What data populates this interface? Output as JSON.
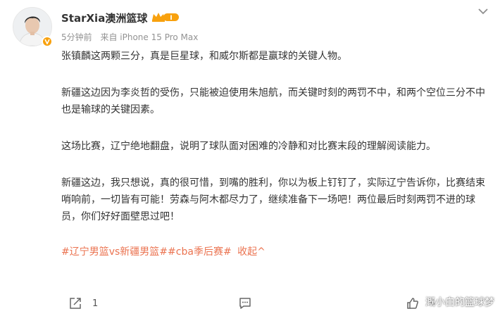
{
  "post": {
    "username": "StarXia澳洲篮球",
    "level_badge": "I",
    "time": "5分钟前",
    "source": "来自 iPhone 15 Pro Max",
    "paragraphs": [
      "张镇麟这两颗三分，真是巨星球，和威尔斯都是赢球的关键人物。",
      "新疆这边因为李炎哲的受伤，只能被迫使用朱旭航，而关键时刻的两罚不中，和两个空位三分不中也是输球的关键因素。",
      "这场比赛，辽宁绝地翻盘，说明了球队面对困难的冷静和对比赛末段的理解阅读能力。",
      "新疆这边，我只想说，真的很可惜，到嘴的胜利，你以为板上钉钉了，实际辽宁告诉你，比赛结束哨响前，一切皆有可能！劳森与阿木都尽力了，继续准备下一场吧！两位最后时刻两罚不进的球员，你们好好面壁思过吧！"
    ],
    "tags": [
      "#辽宁男篮vs新疆男篮#",
      "#cba季后赛#"
    ],
    "collapse_label": "收起",
    "collapse_glyph": "^"
  },
  "actions": {
    "share_count": "1",
    "comment_count": "",
    "like_count": "4"
  },
  "watermark": "溉小白的篮球梦",
  "colors": {
    "tag": "#eb7350",
    "vip_orange": "#f8a10e",
    "meta_gray": "#939393"
  },
  "icons": [
    "more-icon",
    "share-icon",
    "comment-icon",
    "like-icon",
    "verified-badge",
    "level-crown-badge"
  ]
}
